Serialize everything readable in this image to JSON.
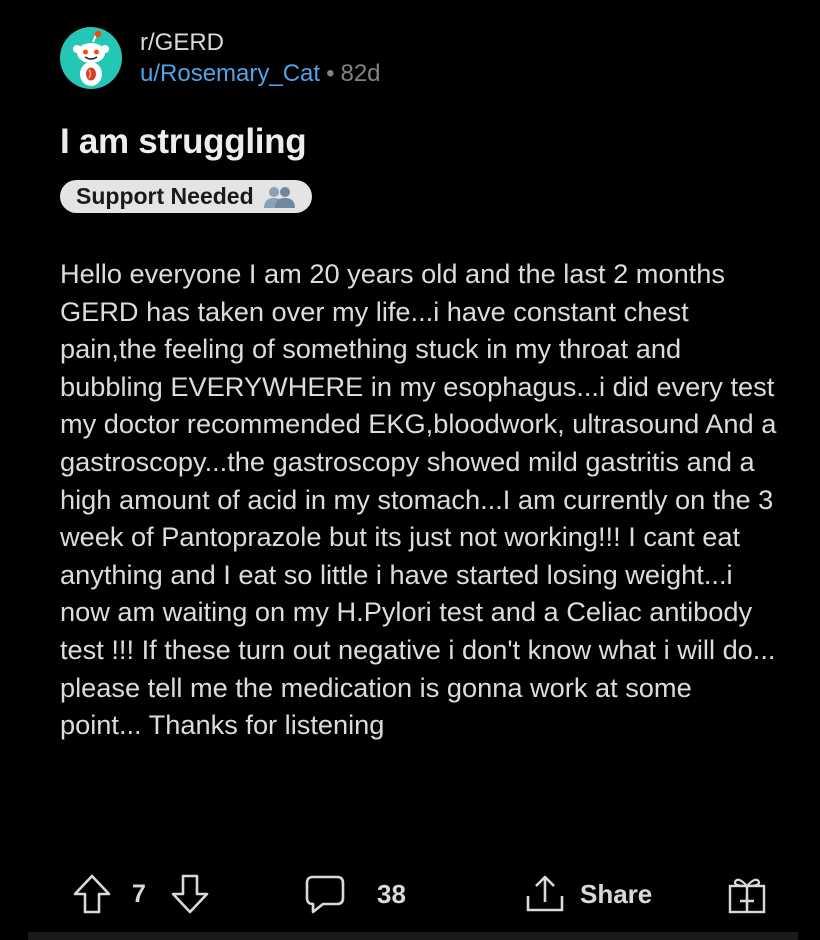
{
  "header": {
    "subreddit": "r/GERD",
    "username": "u/Rosemary_Cat",
    "separator": "•",
    "age": "82d",
    "avatar_icon": "reddit-snoo-icon"
  },
  "post": {
    "title": "I am struggling",
    "flair": {
      "label": "Support Needed",
      "emoji_icon": "busts-in-silhouette-icon"
    },
    "body": "Hello everyone I am 20 years old and the last 2 months GERD has taken over my life...i have constant chest pain,the feeling of something stuck in my throat and bubbling EVERYWHERE in my esophagus...i did every test my doctor recommended EKG,bloodwork, ultrasound And a gastroscopy...the gastroscopy showed mild gastritis and a high amount of acid in my stomach...I am currently on the 3 week of Pantoprazole but its just not working!!! I cant eat anything and I eat so little i have started losing weight...i now am waiting on my H.Pylori test and a Celiac antibody test !!! If these turn out negative i don't know what i will do... please tell me the medication is gonna work at some point... Thanks for listening"
  },
  "actions": {
    "upvote_icon": "arrow-up-icon",
    "score": "7",
    "downvote_icon": "arrow-down-icon",
    "comment_icon": "comment-bubble-icon",
    "comments": "38",
    "share_icon": "share-icon",
    "share_label": "Share",
    "award_icon": "gift-icon"
  },
  "colors": {
    "background": "#000000",
    "username": "#4fa3e6",
    "meta": "#818384",
    "avatar": "#24c7b5",
    "flair_bg": "#e4e4e4"
  }
}
